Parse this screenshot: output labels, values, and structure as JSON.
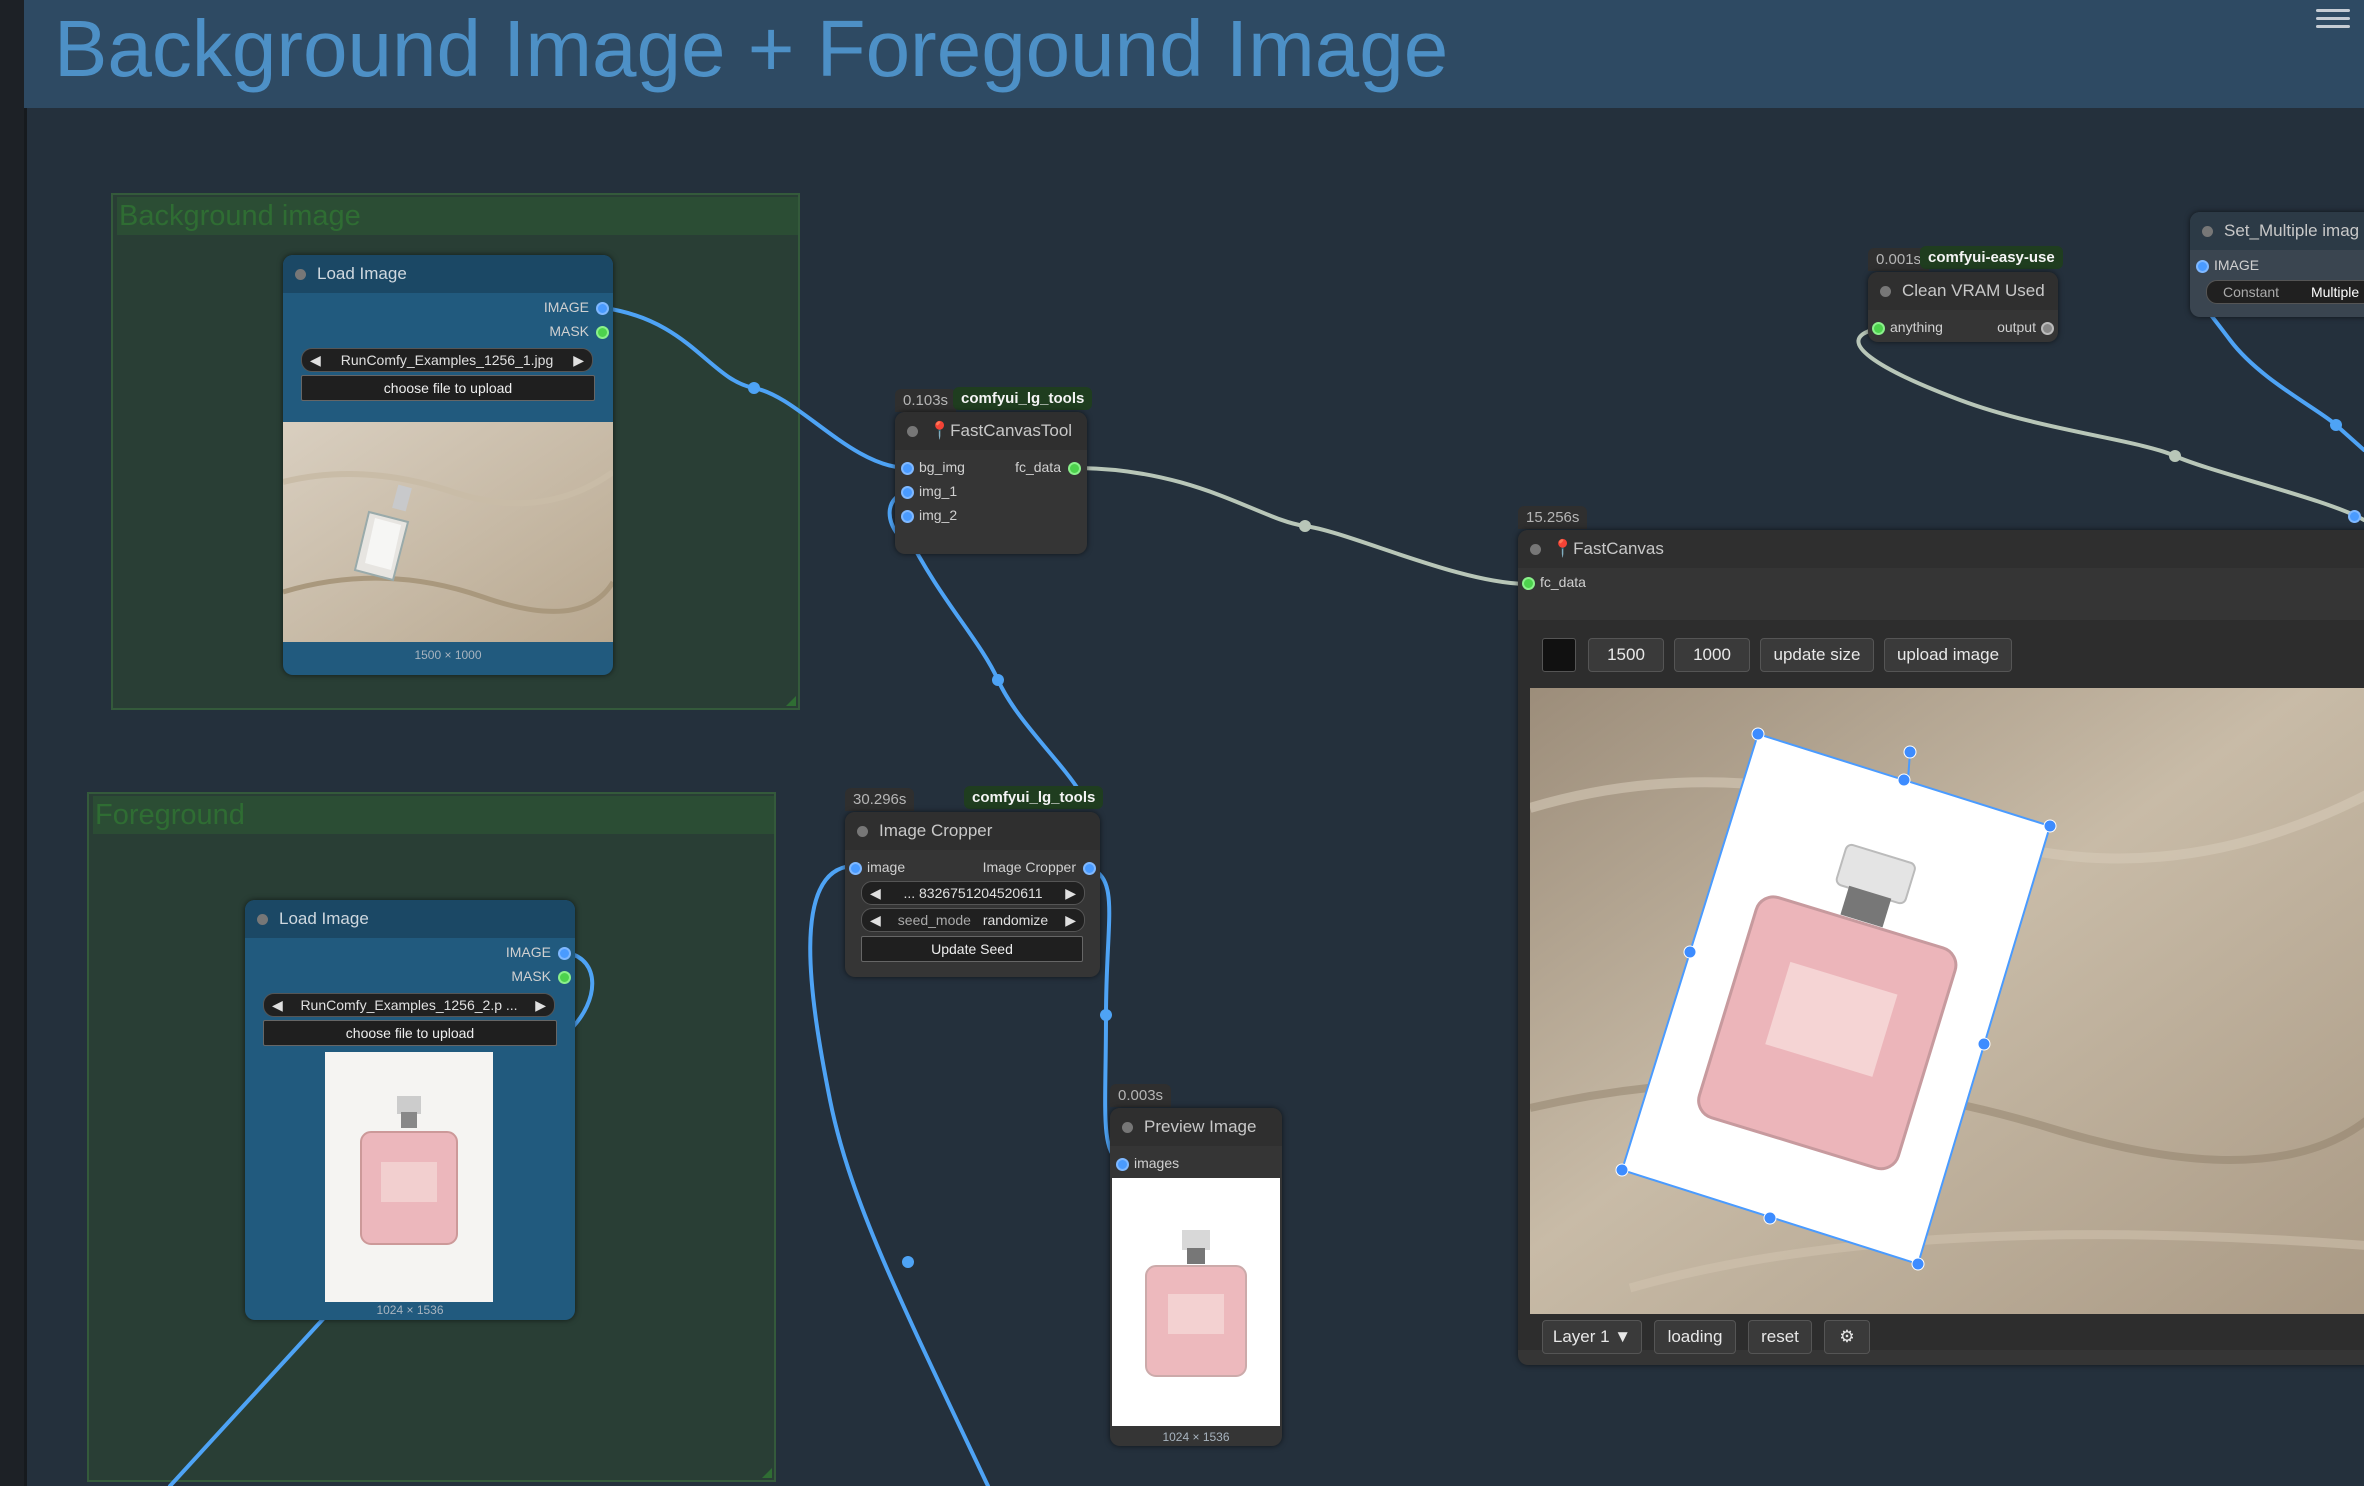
{
  "header": {
    "title": "Background Image + Foregound Image"
  },
  "groups": {
    "background": {
      "title": "Background image"
    },
    "foreground": {
      "title": "Foreground"
    }
  },
  "nodes": {
    "load_bg": {
      "title": "Load Image",
      "outputs": [
        "IMAGE",
        "MASK"
      ],
      "file": "RunComfy_Examples_1256_1.jpg",
      "upload_label": "choose file to upload",
      "size": "1500 × 1000"
    },
    "load_fg": {
      "title": "Load Image",
      "outputs": [
        "IMAGE",
        "MASK"
      ],
      "file": "RunComfy_Examples_1256_2.p ...",
      "upload_label": "choose file to upload",
      "size": "1024 × 1536"
    },
    "fast_canvas_tool": {
      "time": "0.103s",
      "pack": "comfyui_lg_tools",
      "title": "FastCanvasTool",
      "inputs": [
        "bg_img",
        "img_1",
        "img_2"
      ],
      "output": "fc_data"
    },
    "image_cropper": {
      "time": "30.296s",
      "pack": "comfyui_lg_tools",
      "title": "Image Cropper",
      "input": "image",
      "output": "Image Cropper",
      "seed_value": "... 8326751204520611",
      "seed_mode_label": "seed_mode",
      "seed_mode_value": "randomize",
      "update_label": "Update Seed"
    },
    "preview_image": {
      "time": "0.003s",
      "title": "Preview Image",
      "input": "images",
      "size": "1024 × 1536"
    },
    "clean_vram": {
      "time": "0.001s",
      "pack": "comfyui-easy-use",
      "title": "Clean VRAM Used",
      "input": "anything",
      "output": "output"
    },
    "set_multiple": {
      "title": "Set_Multiple imag",
      "input": "IMAGE",
      "widget_label": "Constant",
      "widget_value": "Multiple"
    },
    "fast_canvas": {
      "time": "15.256s",
      "title": "FastCanvas",
      "input": "fc_data",
      "width": "1500",
      "height": "1000",
      "update_size_label": "update size",
      "upload_label": "upload image",
      "layer_label": "Layer 1 ▼",
      "loading_label": "loading",
      "reset_label": "reset"
    }
  },
  "colors": {
    "canvas_bg": "#24303c",
    "title_bar": "#2e4a63",
    "title_text": "#4d90c6",
    "group_bg": "#293e35",
    "node_blue": "#215a7e",
    "node_dark": "#353535",
    "wire_image": "#4ea3f5",
    "wire_data": "#b8c6b8"
  }
}
